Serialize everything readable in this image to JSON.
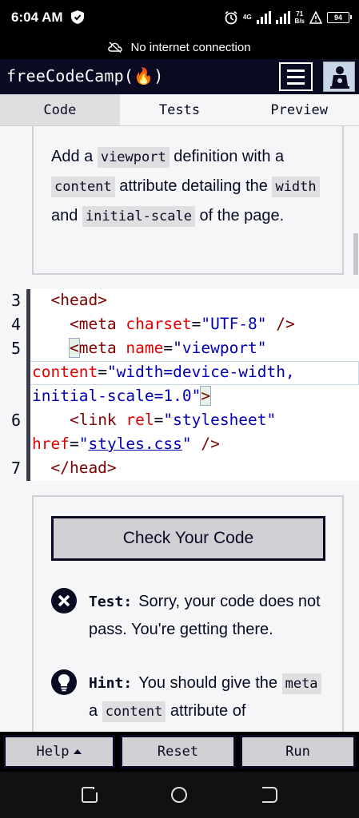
{
  "status_bar": {
    "time": "6:04 AM",
    "network": "4G",
    "speed_value": "71",
    "speed_unit": "B/s",
    "battery": "94"
  },
  "connection_banner": {
    "text": "No internet connection",
    "icon": "cloud-off-icon"
  },
  "navbar": {
    "brand": "freeCodeCamp(🔥)",
    "menu_icon": "hamburger-icon",
    "avatar_icon": "avatar-icon"
  },
  "tabs": [
    {
      "label": "Code",
      "active": true
    },
    {
      "label": "Tests",
      "active": false
    },
    {
      "label": "Preview",
      "active": false
    }
  ],
  "instructions": {
    "t1": "Add a ",
    "c1": "viewport",
    "t2": " definition with a ",
    "c2": "content",
    "t3": " attribute detailing the ",
    "c3": "width",
    "t4": " and ",
    "c4": "initial-scale",
    "t5": " of the page."
  },
  "editor": {
    "line_numbers": [
      "3",
      "4",
      "5",
      "6",
      "7"
    ],
    "lines": {
      "l3": {
        "indent": "  ",
        "open": "<head>"
      },
      "l4": {
        "indent": "    ",
        "tag_open": "<meta",
        "attr": " charset",
        "eq": "=",
        "val": "\"UTF-8\"",
        "close": " />"
      },
      "l5a": {
        "indent": "    ",
        "lt": "<",
        "tag": "meta",
        "attr": " name",
        "eq": "=",
        "val": "\"viewport\""
      },
      "l5b": {
        "attr": "content",
        "eq": "=",
        "val": "\"width=device-width,"
      },
      "l5c": {
        "val": "initial-scale=1.0\"",
        "close": ">"
      },
      "l6a": {
        "indent": "    ",
        "tag_open": "<link",
        "attr": " rel",
        "eq": "=",
        "val": "\"stylesheet\""
      },
      "l6b": {
        "attr": "href",
        "eq": "=",
        "val_q1": "\"",
        "val": "styles.css",
        "val_q2": "\"",
        "close": " />"
      },
      "l7": {
        "indent": "  ",
        "close": "</head>"
      }
    }
  },
  "test_panel": {
    "check_button": "Check Your Code",
    "test_label": "Test:",
    "test_text": "Sorry, your code does not pass. You're getting there.",
    "hint_label": "Hint:",
    "hint_t1": "You should give the ",
    "hint_c1": "meta",
    "hint_t2": " a ",
    "hint_c2": "content",
    "hint_t3": " attribute of"
  },
  "action_bar": {
    "help": "Help",
    "reset": "Reset",
    "run": "Run"
  },
  "colors": {
    "navbar_bg": "#0a0a23",
    "tag": "#800000",
    "attr": "#e50000",
    "string": "#0000b4"
  }
}
